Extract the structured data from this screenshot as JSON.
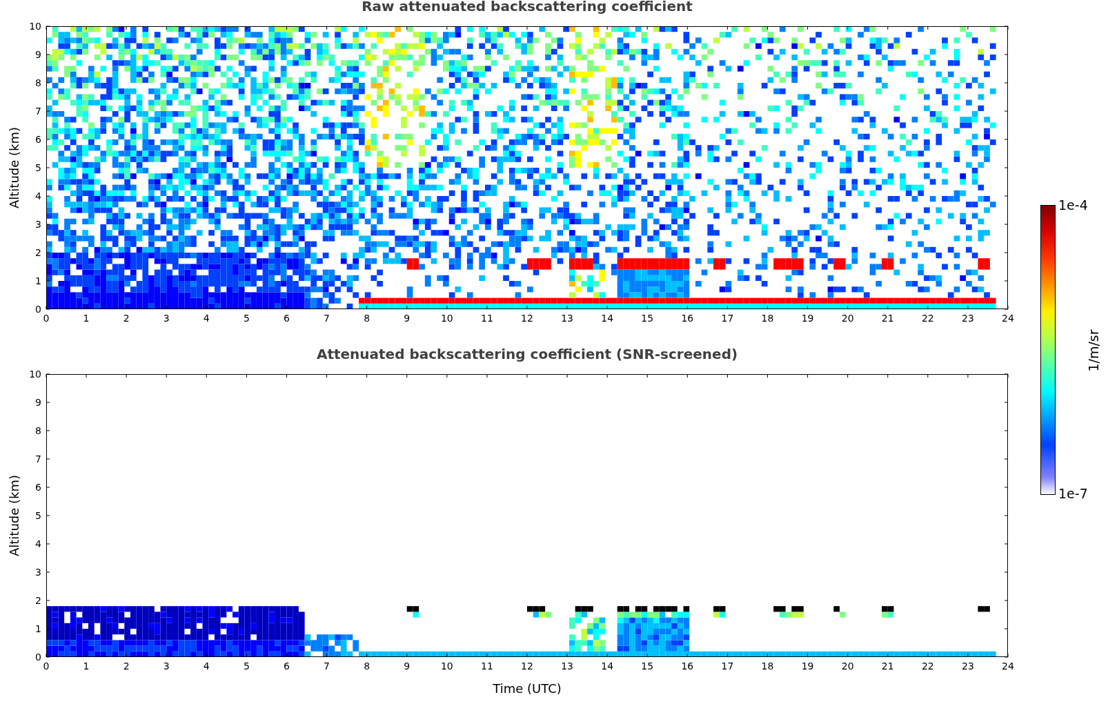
{
  "panels": [
    {
      "kind": "raw",
      "title": "Raw attenuated backscattering coefficient",
      "ylabel": "Altitude (km)",
      "xticks": [
        "0",
        "1",
        "2",
        "3",
        "4",
        "5",
        "6",
        "7",
        "8",
        "9",
        "10",
        "11",
        "12",
        "13",
        "14",
        "15",
        "16",
        "17",
        "18",
        "19",
        "20",
        "21",
        "22",
        "23",
        "24"
      ],
      "yticks": [
        "10",
        "9",
        "8",
        "7",
        "6",
        "5",
        "4",
        "3",
        "2",
        "1",
        "0"
      ]
    },
    {
      "kind": "screened",
      "title": "Attenuated backscattering coefficient (SNR-screened)",
      "ylabel": "Altitude (km)",
      "xlabel": "Time (UTC)",
      "xticks": [
        "0",
        "1",
        "2",
        "3",
        "4",
        "5",
        "6",
        "7",
        "8",
        "9",
        "10",
        "11",
        "12",
        "13",
        "14",
        "15",
        "16",
        "17",
        "18",
        "19",
        "20",
        "21",
        "22",
        "23",
        "24"
      ],
      "yticks": [
        "10",
        "9",
        "8",
        "7",
        "6",
        "5",
        "4",
        "3",
        "2",
        "1",
        "0"
      ]
    }
  ],
  "colorbar": {
    "max_label": "1e-4",
    "min_label": "1e-7",
    "unit": "1/m/sr"
  }
}
